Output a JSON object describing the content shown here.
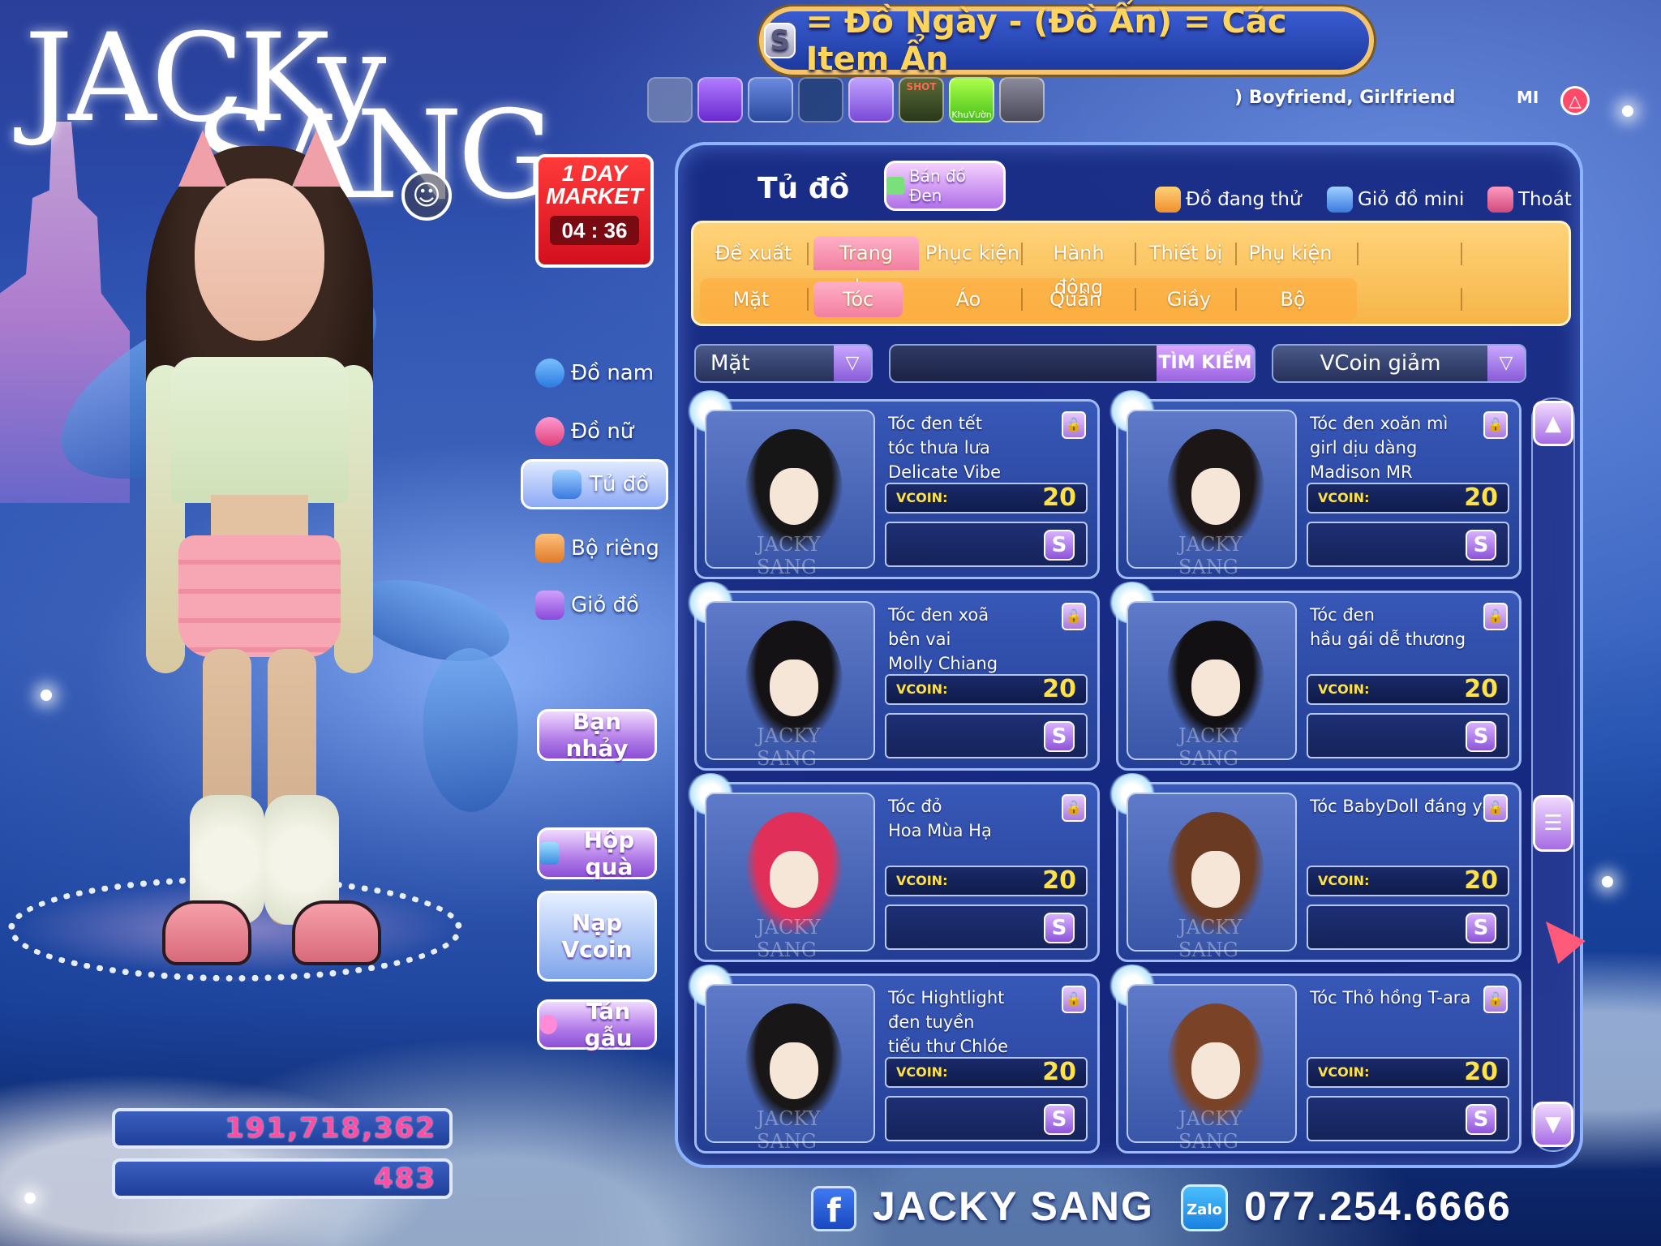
{
  "logo": {
    "line1": "JACKy",
    "line2": "SANG"
  },
  "banner": {
    "s_icon": "S",
    "text": "= Đồ Ngày  -  (Đồ Ẩn) = Các Item Ẩn"
  },
  "top_strip": {
    "icons": [
      "locked-icon",
      "music-icon",
      "pet-icon",
      "dark-icon",
      "gift-icon",
      "photo-icon",
      "khuvuon-icon",
      "settings-icon"
    ],
    "photo_label": "SHOT",
    "garden_label": "KhuVườn",
    "relationship": ") Boyfriend, Girlfriend",
    "mini": "MI"
  },
  "market": {
    "line1": "1 DAY",
    "line2": "MARKET",
    "timer": "04 : 36"
  },
  "side_menu": {
    "do_nam": "Đồ nam",
    "do_nu": "Đồ nữ",
    "tu_do": "Tủ đồ",
    "bo_rieng": "Bộ riêng",
    "gio_do": "Giỏ đồ",
    "ban_nhay": "Bạn nhảy",
    "hop_qua": "Hộp quà",
    "nap_vcoin_1": "Nạp",
    "nap_vcoin_2": "Vcoin",
    "tan_gau": "Tán gẫu"
  },
  "stats": {
    "gold": "191,718,362",
    "vcoin": "483"
  },
  "panel": {
    "title": "Tủ đồ",
    "ban_do_den": "Bán đồ Đen",
    "do_dang_thu": "Đồ đang thử",
    "gio_do_mini": "Giỏ đồ mini",
    "thoat": "Thoát"
  },
  "tabs": [
    {
      "label": "Đề xuất"
    },
    {
      "label": "Trang phục"
    },
    {
      "label": "Phục kiện"
    },
    {
      "label": "Hành động"
    },
    {
      "label": "Thiết bị"
    },
    {
      "label": "Phụ kiện"
    }
  ],
  "subtabs": [
    {
      "label": "Mặt"
    },
    {
      "label": "Tóc"
    },
    {
      "label": "Áo"
    },
    {
      "label": "Quần"
    },
    {
      "label": "Giầy"
    },
    {
      "label": "Bộ"
    }
  ],
  "filter": {
    "category": "Mặt",
    "search_button": "TÌM KIẾM",
    "sort": "VCoin giảm"
  },
  "items": [
    {
      "name1": "Tóc đen tết",
      "name2": "tóc thưa lưa",
      "name3": "Delicate Vibe",
      "price_label": "VCOIN:",
      "price": "20",
      "buy": "S",
      "hair_color": "#161616"
    },
    {
      "name1": "Tóc đen xoăn mì",
      "name2": "girl dịu dàng",
      "name3": "Madison MR",
      "price_label": "VCOIN:",
      "price": "20",
      "buy": "S",
      "hair_color": "#1c1616"
    },
    {
      "name1": "Tóc đen xoã",
      "name2": "bên vai",
      "name3": "Molly Chiang",
      "price_label": "VCOIN:",
      "price": "20",
      "buy": "S",
      "hair_color": "#141214"
    },
    {
      "name1": "Tóc đen",
      "name2": "hầu gái dễ thương",
      "name3": "",
      "price_label": "VCOIN:",
      "price": "20",
      "buy": "S",
      "hair_color": "#121012"
    },
    {
      "name1": "Tóc đỏ",
      "name2": "Hoa Mùa Hạ",
      "name3": "",
      "price_label": "VCOIN:",
      "price": "20",
      "buy": "S",
      "hair_color": "#e0305a"
    },
    {
      "name1": "Tóc BabyDoll đáng yêu",
      "name2": "",
      "name3": "",
      "price_label": "VCOIN:",
      "price": "20",
      "buy": "S",
      "hair_color": "#6a3a22"
    },
    {
      "name1": "Tóc Hightlight",
      "name2": "đen tuyền",
      "name3": "tiểu thư Chlóe",
      "price_label": "VCOIN:",
      "price": "20",
      "buy": "S",
      "hair_color": "#181616"
    },
    {
      "name1": "Tóc Thỏ hồng T-ara",
      "name2": "",
      "name3": "",
      "price_label": "VCOIN:",
      "price": "20",
      "buy": "S",
      "hair_color": "#7a4328"
    }
  ],
  "watermark": "JACKY SANG",
  "scroll": {
    "up": "▲",
    "mid": "☰",
    "down": "▼"
  },
  "footer": {
    "fb_icon": "f",
    "fb_name": "JACKY SANG",
    "zalo_icon": "Zalo",
    "phone": "077.254.6666"
  }
}
